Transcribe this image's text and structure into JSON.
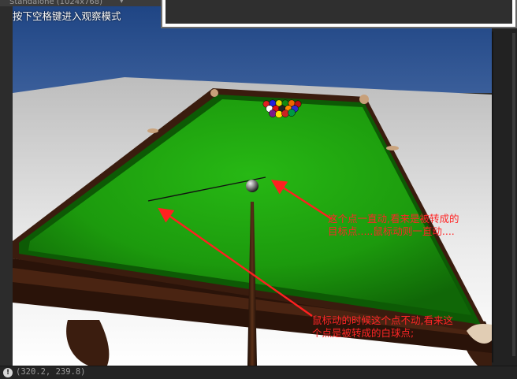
{
  "window": {
    "title": "Standalone (1024x768)",
    "menu_glyph": "▾"
  },
  "game": {
    "hint": "按下空格键进入观察模式"
  },
  "annotations": {
    "top": "这个点一直动,看来是被转成的\n目标点.....鼠标动则一直动....",
    "bottom": "鼠标动的时候这个点不动,看来这\n个点是被转成的白球点;"
  },
  "status_bar": {
    "icon_glyph": "!",
    "coordinates": "(320.2, 239.8)"
  },
  "colors": {
    "felt": "#1f9a0e",
    "felt_dark": "#0f5e07",
    "wood": "#3a1d10",
    "sky": "#2b4f8f",
    "annotation": "#ff2626"
  }
}
